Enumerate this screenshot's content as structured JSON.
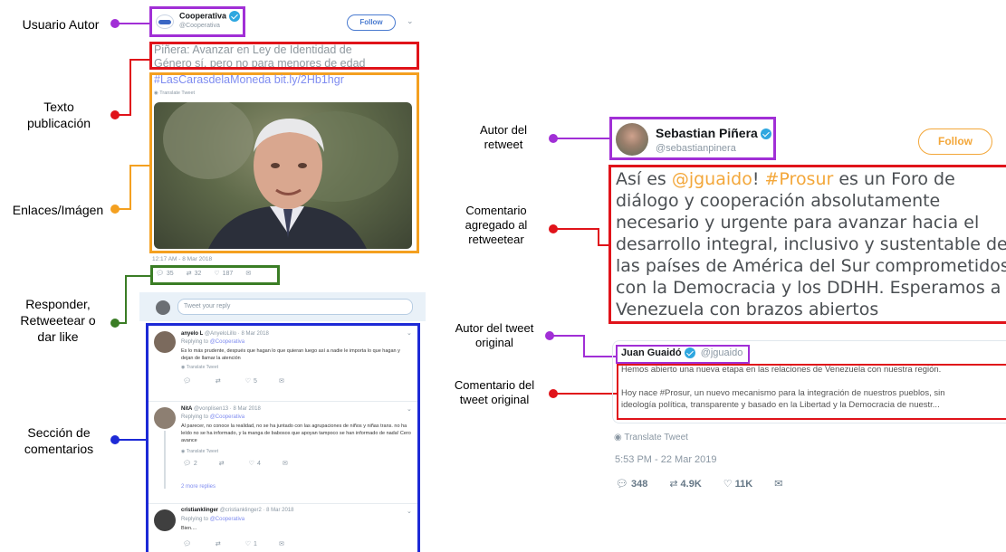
{
  "colors": {
    "purple": "#a12fd6",
    "red": "#e0131a",
    "orange": "#f4a020",
    "green": "#3a7d25",
    "blue": "#1d2ad6"
  },
  "labels": {
    "usuario_autor": "Usuario Autor",
    "texto_publicacion_1": "Texto",
    "texto_publicacion_2": "publicación",
    "enlaces": "Enlaces/Imágen",
    "responder_1": "Responder,",
    "responder_2": "Retweetear o",
    "responder_3": "dar like",
    "seccion_1": "Sección de",
    "seccion_2": "comentarios",
    "autor_retweet_1": "Autor del",
    "autor_retweet_2": "retweet",
    "comentario_agregado_1": "Comentario",
    "comentario_agregado_2": "agregado al",
    "comentario_agregado_3": "retweetear",
    "autor_original_1": "Autor del tweet",
    "autor_original_2": "original",
    "comentario_original_1": "Comentario del",
    "comentario_original_2": "tweet original"
  },
  "left_tweet": {
    "author_name": "Cooperativa",
    "author_handle": "@Cooperativa",
    "follow_label": "Follow",
    "text_line1": "Piñera: Avanzar en Ley de Identidad de",
    "text_line2": "Género sí, pero no para menores de edad",
    "hashtag": "#LasCarasdelaMoneda",
    "link": "bit.ly/2Hb1hgr",
    "translate": "Translate Tweet",
    "timestamp": "12:17 AM - 8 Mar 2018",
    "replies": "35",
    "retweets": "32",
    "likes": "187",
    "reply_placeholder": "Tweet your reply"
  },
  "comments": [
    {
      "name": "anyelo L",
      "handle": "@AnyeloLillo · 8 Mar 2018",
      "replying": "Replying to",
      "replying_to": "@Cooperativa",
      "text": "Es lo más prudente, después que hagan lo que quieran luego así a nadie le importa lo que hagan y dejan de llamar la atención",
      "translate": "Translate Tweet",
      "replies": "",
      "retweets": "",
      "likes": "5"
    },
    {
      "name": "NitA",
      "handle": "@vonplisen13 · 8 Mar 2018",
      "replying": "Replying to",
      "replying_to": "@Cooperativa",
      "text": "Al parecer, no conoce la realidad, no se ha juntado con las agrupaciones de niños y niñas trans. no ha leído no se ha informado, y la manga de babosos que apoyan tampoco se han informado de nada! Cero avance",
      "translate": "Translate Tweet",
      "replies": "2",
      "retweets": "",
      "likes": "4",
      "more_replies": "2 more replies"
    },
    {
      "name": "cristianklinger",
      "handle": "@cristianklinger2 · 8 Mar 2018",
      "replying": "Replying to",
      "replying_to": "@Cooperativa",
      "text": "Bien....",
      "replies": "",
      "retweets": "",
      "likes": "1"
    }
  ],
  "right_tweet": {
    "author_name": "Sebastian Piñera",
    "author_handle": "@sebastianpinera",
    "follow_label": "Follow",
    "text_pre": "Así es ",
    "mention": "@jguaido",
    "text_mid": "! ",
    "hashtag": "#Prosur",
    "text_l1_rest": " es un Foro de",
    "text_l2": "diálogo y cooperación absolutamente",
    "text_l3": "necesario y urgente para avanzar hacia el",
    "text_l4": "desarrollo integral, inclusivo y sustentable de",
    "text_l5": "las países de América del Sur comprometidos",
    "text_l6": "con la Democracia y los DDHH. Esperamos a",
    "text_l7": "Venezuela con brazos abiertos",
    "quoted_name": "Juan Guaidó",
    "quoted_handle": "@jguaido",
    "quoted_line1": "Hemos abierto una nueva etapa en las relaciones de Venezuela con nuestra región.",
    "quoted_line2": "Hoy nace #Prosur, un nuevo mecanismo para la integración de nuestros pueblos, sin",
    "quoted_line3": "ideología política, transparente y basado en la Libertad y la Democracia de nuestr...",
    "translate": "Translate Tweet",
    "timestamp": "5:53 PM - 22 Mar 2019",
    "replies": "348",
    "retweets": "4.9K",
    "likes": "11K"
  }
}
